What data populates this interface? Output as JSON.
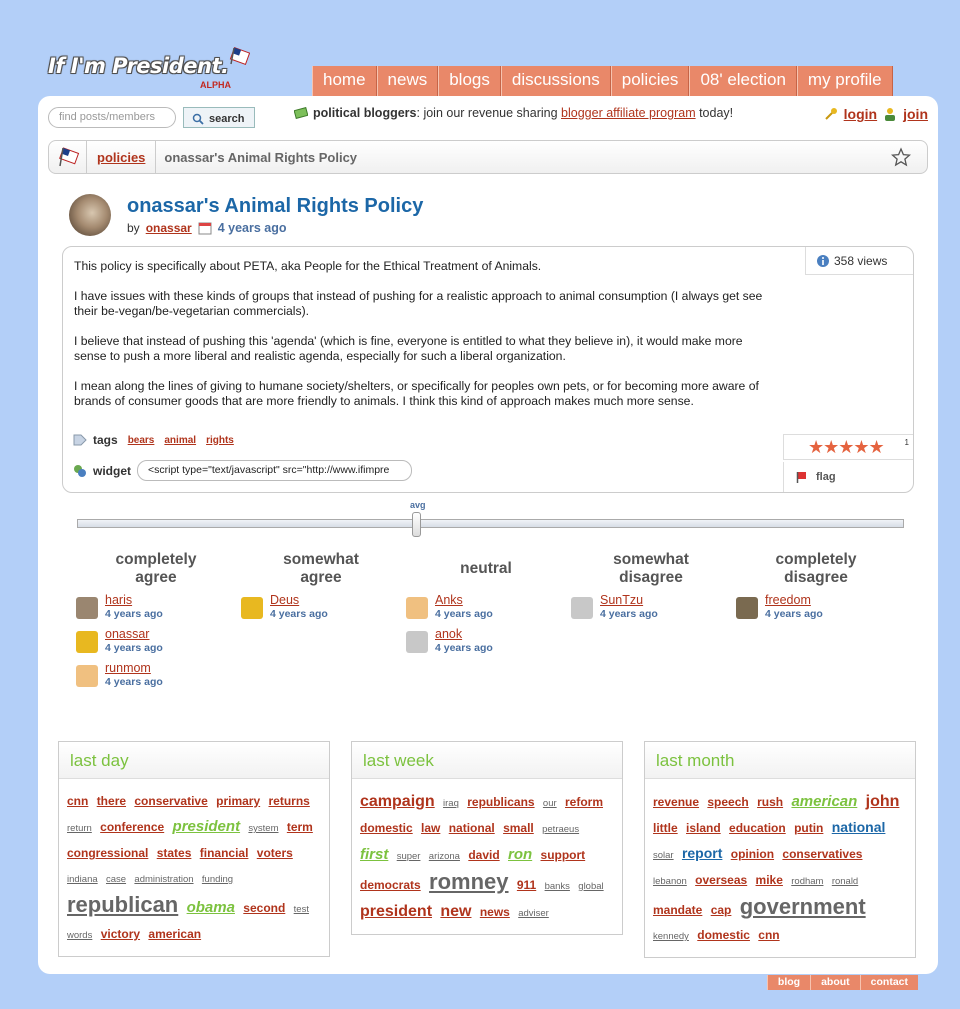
{
  "logo": {
    "text": "If I'm President.",
    "alpha": "ALPHA"
  },
  "nav": [
    "home",
    "news",
    "blogs",
    "discussions",
    "policies",
    "08' election",
    "my profile"
  ],
  "search": {
    "placeholder": "find posts/members",
    "button": "search"
  },
  "promo": {
    "bold": "political bloggers",
    "text": ": join our revenue sharing ",
    "link": "blogger affiliate program",
    "tail": " today!"
  },
  "auth": {
    "login": "login",
    "join": "join"
  },
  "breadcrumb": {
    "section": "policies",
    "current": "onassar's Animal Rights Policy"
  },
  "post": {
    "title": "onassar's Animal Rights Policy",
    "by": "by",
    "author": "onassar",
    "time": "4 years ago",
    "views": "358 views",
    "paragraphs": [
      "This policy is specifically about PETA, aka People for the Ethical Treatment of Animals.",
      "I have issues with these kinds of groups that instead of pushing for a realistic approach to animal consumption (I always get see their be-vegan/be-vegetarian commercials).",
      "I believe that instead of pushing this 'agenda' (which is fine, everyone is entitled to what they believe in), it would make more sense to push a more liberal and realistic agenda, especially for such a liberal organization.",
      "I mean along the lines of giving to humane society/shelters, or specifically for peoples own pets, or for becoming more aware of brands of consumer goods that are more friendly to animals. I think this kind of approach makes much more sense."
    ],
    "tags_label": "tags",
    "tags": [
      "bears",
      "animal",
      "rights"
    ],
    "widget_label": "widget",
    "widget_code": "<script type=\"text/javascript\" src=\"http://www.ifimpre",
    "rating_stars": 5,
    "rating_count": "1",
    "flag": "flag"
  },
  "slider": {
    "label": "avg",
    "value": 0.41
  },
  "stances": [
    {
      "head": "completely\nagree",
      "voters": [
        {
          "name": "haris",
          "time": "4 years ago"
        },
        {
          "name": "onassar",
          "time": "4 years ago"
        },
        {
          "name": "runmom",
          "time": "4 years ago"
        }
      ]
    },
    {
      "head": "somewhat\nagree",
      "voters": [
        {
          "name": "Deus",
          "time": "4 years ago"
        }
      ]
    },
    {
      "head": "neutral",
      "voters": [
        {
          "name": "Anks",
          "time": "4 years ago"
        },
        {
          "name": "anok",
          "time": "4 years ago"
        }
      ]
    },
    {
      "head": "somewhat\ndisagree",
      "voters": [
        {
          "name": "SunTzu",
          "time": "4 years ago"
        }
      ]
    },
    {
      "head": "completely\ndisagree",
      "voters": [
        {
          "name": "freedom",
          "time": "4 years ago"
        }
      ]
    }
  ],
  "clouds": [
    {
      "title": "last day",
      "words": [
        [
          "cnn",
          "m"
        ],
        [
          "there",
          "m"
        ],
        [
          "conservative",
          "m"
        ],
        [
          "primary",
          "m"
        ],
        [
          "returns",
          "m"
        ],
        [
          "return",
          "s"
        ],
        [
          "conference",
          "m"
        ],
        [
          "president",
          "g"
        ],
        [
          "system",
          "s"
        ],
        [
          "term",
          "m"
        ],
        [
          "congressional",
          "m"
        ],
        [
          "states",
          "m"
        ],
        [
          "financial",
          "m"
        ],
        [
          "voters",
          "m"
        ],
        [
          "indiana",
          "s"
        ],
        [
          "case",
          "s"
        ],
        [
          "administration",
          "s"
        ],
        [
          "funding",
          "s"
        ],
        [
          "republican",
          "xl"
        ],
        [
          "obama",
          "g"
        ],
        [
          "second",
          "m"
        ],
        [
          "test",
          "s"
        ],
        [
          "words",
          "s"
        ],
        [
          "victory",
          "m"
        ],
        [
          "american",
          "m"
        ]
      ]
    },
    {
      "title": "last week",
      "words": [
        [
          "campaign",
          "l"
        ],
        [
          "iraq",
          "s"
        ],
        [
          "republicans",
          "m"
        ],
        [
          "our",
          "s"
        ],
        [
          "reform",
          "m"
        ],
        [
          "domestic",
          "m"
        ],
        [
          "law",
          "m"
        ],
        [
          "national",
          "m"
        ],
        [
          "small",
          "m"
        ],
        [
          "petraeus",
          "s"
        ],
        [
          "first",
          "g"
        ],
        [
          "super",
          "s"
        ],
        [
          "arizona",
          "s"
        ],
        [
          "david",
          "m"
        ],
        [
          "ron",
          "g"
        ],
        [
          "support",
          "m"
        ],
        [
          "democrats",
          "m"
        ],
        [
          "romney",
          "xl"
        ],
        [
          "911",
          "m"
        ],
        [
          "banks",
          "s"
        ],
        [
          "global",
          "s"
        ],
        [
          "president",
          "l"
        ],
        [
          "new",
          "l"
        ],
        [
          "news",
          "m"
        ],
        [
          "adviser",
          "s"
        ]
      ]
    },
    {
      "title": "last month",
      "words": [
        [
          "revenue",
          "m"
        ],
        [
          "speech",
          "m"
        ],
        [
          "rush",
          "m"
        ],
        [
          "american",
          "g"
        ],
        [
          "john",
          "l"
        ],
        [
          "little",
          "m"
        ],
        [
          "island",
          "m"
        ],
        [
          "education",
          "m"
        ],
        [
          "putin",
          "m"
        ],
        [
          "national",
          "b"
        ],
        [
          "solar",
          "s"
        ],
        [
          "report",
          "b"
        ],
        [
          "opinion",
          "m"
        ],
        [
          "conservatives",
          "m"
        ],
        [
          "lebanon",
          "s"
        ],
        [
          "overseas",
          "m"
        ],
        [
          "mike",
          "m"
        ],
        [
          "rodham",
          "s"
        ],
        [
          "ronald",
          "s"
        ],
        [
          "mandate",
          "m"
        ],
        [
          "cap",
          "m"
        ],
        [
          "government",
          "xl"
        ],
        [
          "kennedy",
          "s"
        ],
        [
          "domestic",
          "m"
        ],
        [
          "cnn",
          "m"
        ]
      ]
    }
  ],
  "footer": [
    "blog",
    "about",
    "contact"
  ]
}
